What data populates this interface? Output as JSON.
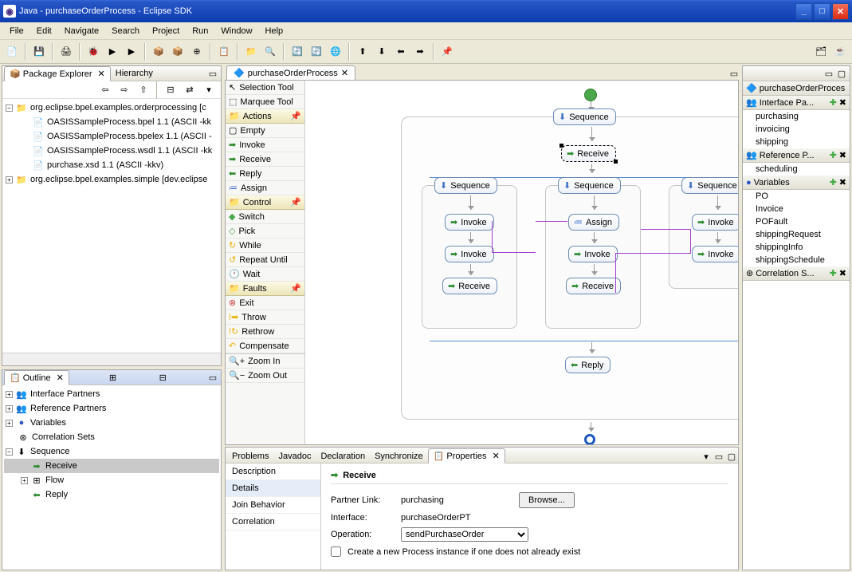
{
  "window": {
    "title": "Java - purchaseOrderProcess - Eclipse SDK"
  },
  "menu": [
    "File",
    "Edit",
    "Navigate",
    "Search",
    "Project",
    "Run",
    "Window",
    "Help"
  ],
  "views": {
    "explorer": {
      "tab1": "Package Explorer",
      "tab2": "Hierarchy"
    },
    "outline": {
      "title": "Outline"
    }
  },
  "explorer_tree": {
    "pkg1": "org.eclipse.bpel.examples.orderprocessing  [c",
    "f1": "OASISSampleProcess.bpel 1.1 (ASCII -kk",
    "f2": "OASISSampleProcess.bpelex 1.1 (ASCII -",
    "f3": "OASISSampleProcess.wsdl 1.1 (ASCII -kk",
    "f4": "purchase.xsd 1.1 (ASCII -kkv)",
    "pkg2": "org.eclipse.bpel.examples.simple  [dev.eclipse"
  },
  "outline_tree": {
    "i1": "Interface Partners",
    "i2": "Reference Partners",
    "i3": "Variables",
    "i4": "Correlation Sets",
    "i5": "Sequence",
    "i5a": "Receive",
    "i5b": "Flow",
    "i5c": "Reply"
  },
  "editor": {
    "tab": "purchaseOrderProcess"
  },
  "palette": {
    "sel": "Selection Tool",
    "marq": "Marquee Tool",
    "cat_actions": "Actions",
    "empty": "Empty",
    "invoke": "Invoke",
    "receive": "Receive",
    "reply": "Reply",
    "assign": "Assign",
    "cat_control": "Control",
    "switch": "Switch",
    "pick": "Pick",
    "while": "While",
    "repeat": "Repeat Until",
    "wait": "Wait",
    "cat_faults": "Faults",
    "exit": "Exit",
    "throw": "Throw",
    "rethrow": "Rethrow",
    "compensate": "Compensate",
    "zoomin": "Zoom In",
    "zoomout": "Zoom Out"
  },
  "diagram": {
    "sequence": "Sequence",
    "receive": "Receive",
    "invoke": "Invoke",
    "assign": "Assign",
    "reply": "Reply"
  },
  "bottom_tabs": {
    "problems": "Problems",
    "javadoc": "Javadoc",
    "declaration": "Declaration",
    "synchronize": "Synchronize",
    "properties": "Properties"
  },
  "prop_nav": {
    "desc": "Description",
    "details": "Details",
    "join": "Join Behavior",
    "corr": "Correlation"
  },
  "properties": {
    "title": "Receive",
    "partner_label": "Partner Link:",
    "partner_value": "purchasing",
    "browse": "Browse...",
    "interface_label": "Interface:",
    "interface_value": "purchaseOrderPT",
    "operation_label": "Operation:",
    "operation_value": "sendPurchaseOrder",
    "checkbox": "Create a new Process instance if one does not already exist"
  },
  "right": {
    "root": "purchaseOrderProces",
    "interface": "Interface Pa...",
    "purchasing": "purchasing",
    "invoicing": "invoicing",
    "shipping": "shipping",
    "reference": "Reference P...",
    "scheduling": "scheduling",
    "variables": "Variables",
    "po": "PO",
    "invoice": "Invoice",
    "pofault": "POFault",
    "shipreq": "shippingRequest",
    "shipinfo": "shippingInfo",
    "shipsched": "shippingSchedule",
    "corrsets": "Correlation S..."
  }
}
